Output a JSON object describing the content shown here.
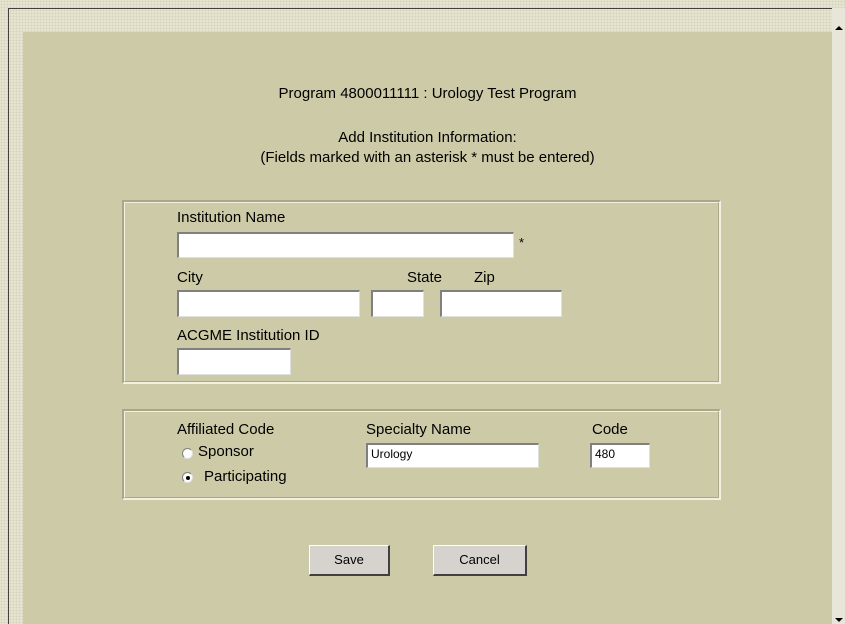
{
  "header": {
    "program_line": "Program 4800011111 : Urology Test Program",
    "subtitle": "Add Institution Information:",
    "note": "(Fields marked with an asterisk * must be entered)"
  },
  "institution": {
    "name_label": "Institution Name",
    "name_value": "",
    "required_marker": "*",
    "city_label": "City",
    "city_value": "",
    "state_label": "State",
    "state_value": "",
    "zip_label": "Zip",
    "zip_value": "",
    "acgme_label": "ACGME Institution ID",
    "acgme_value": ""
  },
  "affiliation": {
    "affiliated_code_label": "Affiliated Code",
    "sponsor_label": "Sponsor",
    "participating_label": "Participating",
    "selected": "Participating",
    "specialty_label": "Specialty Name",
    "specialty_value": "Urology",
    "code_label": "Code",
    "code_value": "480"
  },
  "actions": {
    "save_label": "Save",
    "cancel_label": "Cancel"
  }
}
